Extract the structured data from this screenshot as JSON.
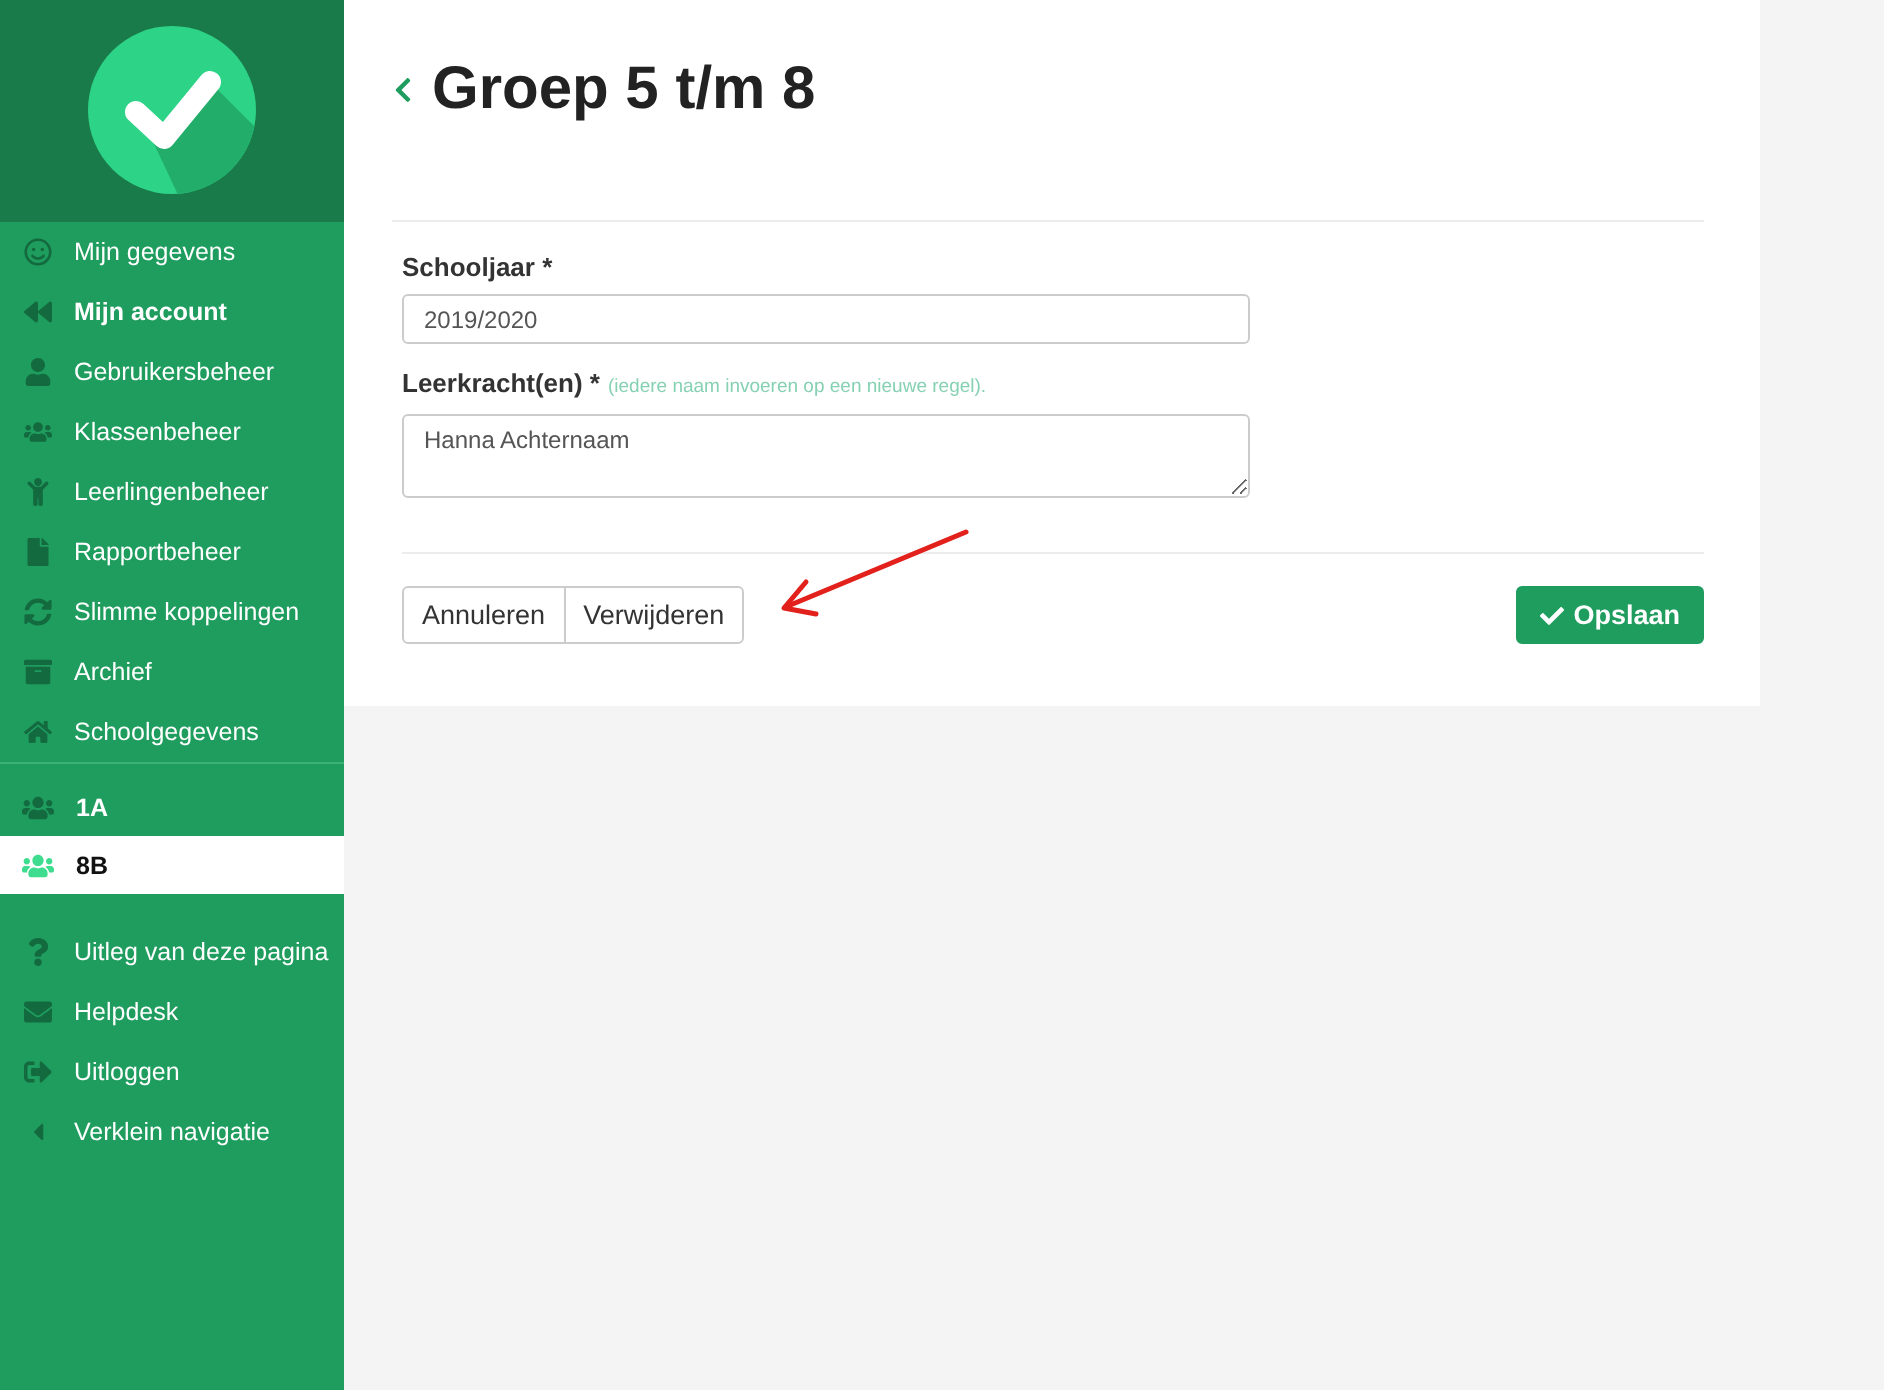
{
  "sidebar": {
    "menu": [
      {
        "label": "Mijn gegevens",
        "selected": false
      },
      {
        "label": "Mijn account",
        "selected": true
      },
      {
        "label": "Gebruikersbeheer",
        "selected": false
      },
      {
        "label": "Klassenbeheer",
        "selected": false
      },
      {
        "label": "Leerlingenbeheer",
        "selected": false
      },
      {
        "label": "Rapportbeheer",
        "selected": false
      },
      {
        "label": "Slimme koppelingen",
        "selected": false
      },
      {
        "label": "Archief",
        "selected": false
      },
      {
        "label": "Schoolgegevens",
        "selected": false
      }
    ],
    "classes": [
      {
        "label": "1A",
        "selected": false
      },
      {
        "label": "8B",
        "selected": true
      }
    ],
    "help": [
      {
        "label": "Uitleg van deze pagina"
      },
      {
        "label": "Helpdesk"
      },
      {
        "label": "Uitloggen"
      },
      {
        "label": "Verklein navigatie"
      }
    ]
  },
  "page": {
    "title": "Groep 5 t/m 8",
    "fields": [
      {
        "kind": "input",
        "label": "Schooljaar *",
        "value": "2019/2020"
      },
      {
        "kind": "textarea",
        "label": "Leerkracht(en) *",
        "hint": "(iedere naam invoeren op een nieuwe regel).",
        "value": "Hanna Achternaam"
      }
    ],
    "buttons": [
      {
        "kind": "default",
        "label": "Annuleren"
      },
      {
        "kind": "default",
        "label": "Verwijderen"
      },
      {
        "kind": "primary",
        "label": "Opslaan"
      }
    ]
  },
  "annotation": {
    "kind": "arrow"
  }
}
